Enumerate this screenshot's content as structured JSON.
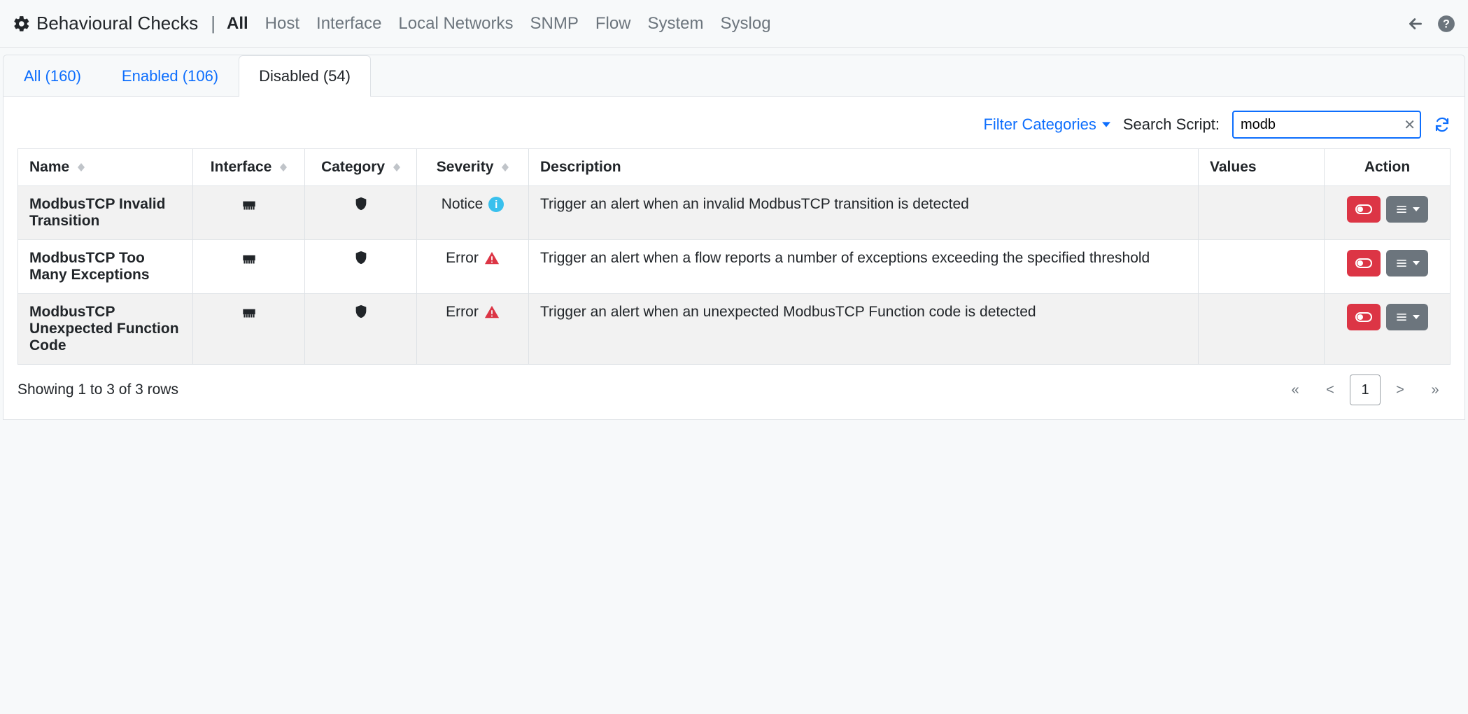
{
  "header": {
    "title": "Behavioural Checks",
    "nav": [
      "All",
      "Host",
      "Interface",
      "Local Networks",
      "SNMP",
      "Flow",
      "System",
      "Syslog"
    ],
    "active_nav": "All"
  },
  "tabs": {
    "all": "All (160)",
    "enabled": "Enabled (106)",
    "disabled": "Disabled (54)",
    "active": "disabled"
  },
  "toolbar": {
    "filter_label": "Filter Categories",
    "search_label": "Search Script:",
    "search_value": "modb"
  },
  "columns": {
    "name": "Name",
    "interface": "Interface",
    "category": "Category",
    "severity": "Severity",
    "description": "Description",
    "values": "Values",
    "action": "Action"
  },
  "severity_labels": {
    "notice": "Notice",
    "error": "Error"
  },
  "rows": [
    {
      "name": "ModbusTCP Invalid Transition",
      "severity": "notice",
      "description": "Trigger an alert when an invalid ModbusTCP transition is detected"
    },
    {
      "name": "ModbusTCP Too Many Exceptions",
      "severity": "error",
      "description": "Trigger an alert when a flow reports a number of exceptions exceeding the specified threshold"
    },
    {
      "name": "ModbusTCP Unexpected Function Code",
      "severity": "error",
      "description": "Trigger an alert when an unexpected ModbusTCP Function code is detected"
    }
  ],
  "footer": {
    "summary": "Showing 1 to 3 of 3 rows",
    "pages": [
      "«",
      "<",
      "1",
      ">",
      "»"
    ],
    "active_page": "1"
  }
}
